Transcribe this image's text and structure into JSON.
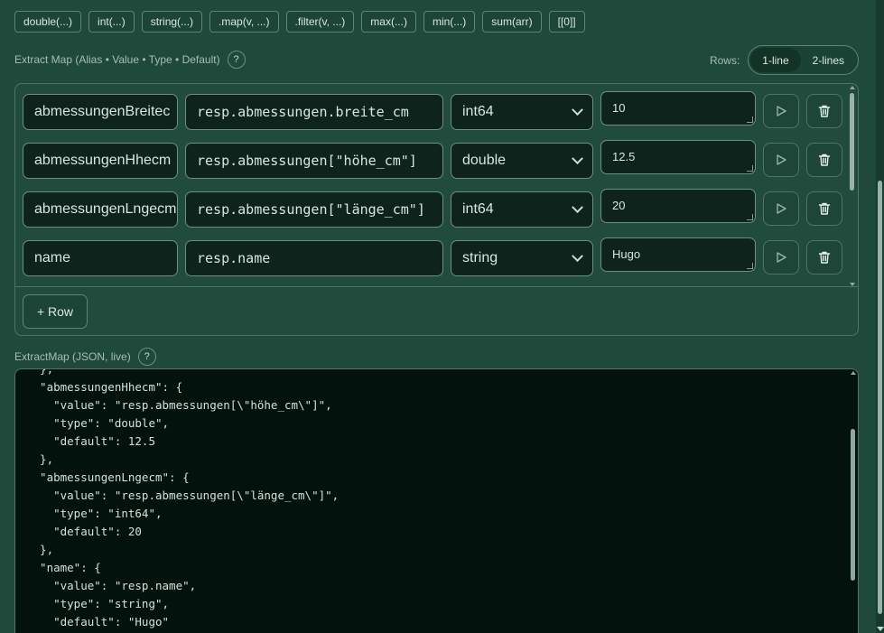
{
  "snippets": [
    "double(...)",
    "int(...)",
    "string(...)",
    ".map(v, ...)",
    ".filter(v, ...)",
    "max(...)",
    "min(...)",
    "sum(arr)",
    "[[0]]"
  ],
  "extract_map": {
    "label": "Extract Map (Alias • Value • Type • Default)",
    "help": "?",
    "rows_label": "Rows:",
    "rows_options": [
      "1-line",
      "2-lines"
    ],
    "rows_selected": "1-line",
    "rows": [
      {
        "alias": "abmessungenBreitec",
        "value": "resp.abmessungen.breite_cm",
        "type": "int64",
        "default": "10"
      },
      {
        "alias": "abmessungenHhecm",
        "value": "resp.abmessungen[\"höhe_cm\"]",
        "type": "double",
        "default": "12.5"
      },
      {
        "alias": "abmessungenLngecm",
        "value": "resp.abmessungen[\"länge_cm\"]",
        "type": "int64",
        "default": "20"
      },
      {
        "alias": "name",
        "value": "resp.name",
        "type": "string",
        "default": "Hugo"
      }
    ],
    "add_row_label": "+ Row"
  },
  "json_panel": {
    "label": "ExtractMap (JSON, live)",
    "help": "?",
    "text": "  },\n  \"abmessungenHhecm\": {\n    \"value\": \"resp.abmessungen[\\\"höhe_cm\\\"]\",\n    \"type\": \"double\",\n    \"default\": 12.5\n  },\n  \"abmessungenLngecm\": {\n    \"value\": \"resp.abmessungen[\\\"länge_cm\\\"]\",\n    \"type\": \"int64\",\n    \"default\": 20\n  },\n  \"name\": {\n    \"value\": \"resp.name\",\n    \"type\": \"string\",\n    \"default\": \"Hugo\"\n  }"
  },
  "icons": {
    "run": "play-icon",
    "delete": "trash-icon",
    "type_dropdown": "chevron-down-icon"
  },
  "colors": {
    "background": "#1f4a3b",
    "editor_bg": "#03120d",
    "border": "#4d7466"
  }
}
